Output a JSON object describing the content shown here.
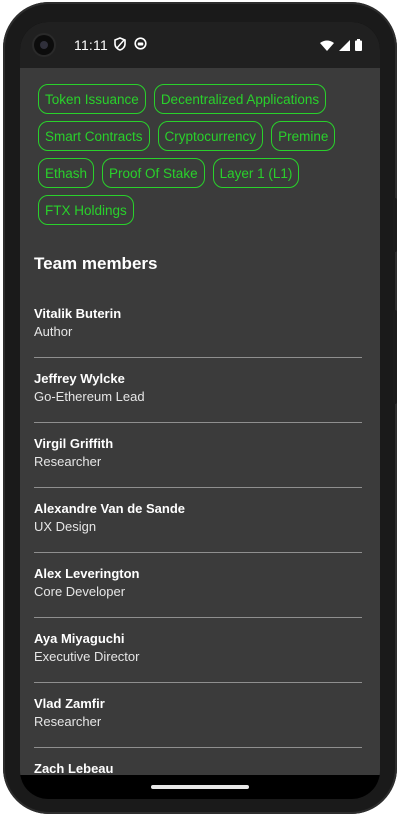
{
  "status_bar": {
    "time": "11:11"
  },
  "tags": [
    "Token Issuance",
    "Decentralized Applications",
    "Smart Contracts",
    "Cryptocurrency",
    "Premine",
    "Ethash",
    "Proof Of Stake",
    "Layer 1 (L1)",
    "FTX Holdings"
  ],
  "team": {
    "title": "Team members",
    "members": [
      {
        "name": "Vitalik Buterin",
        "role": "Author"
      },
      {
        "name": "Jeffrey Wylcke",
        "role": "Go-Ethereum Lead"
      },
      {
        "name": "Virgil Griffith",
        "role": "Researcher"
      },
      {
        "name": "Alexandre Van de Sande",
        "role": "UX Design"
      },
      {
        "name": "Alex Leverington",
        "role": "Core Developer"
      },
      {
        "name": "Aya Miyaguchi",
        "role": "Executive Director"
      },
      {
        "name": "Vlad Zamfir",
        "role": "Researcher"
      },
      {
        "name": "Zach Lebeau",
        "role": ""
      }
    ]
  },
  "colors": {
    "tag_accent": "#29d12b",
    "background": "#3b3b3b",
    "divider": "#8f8f8f"
  },
  "icons": {
    "status_left": [
      "shield-icon",
      "app-notification-icon"
    ],
    "status_right": [
      "wifi-icon",
      "signal-icon",
      "battery-icon"
    ]
  }
}
